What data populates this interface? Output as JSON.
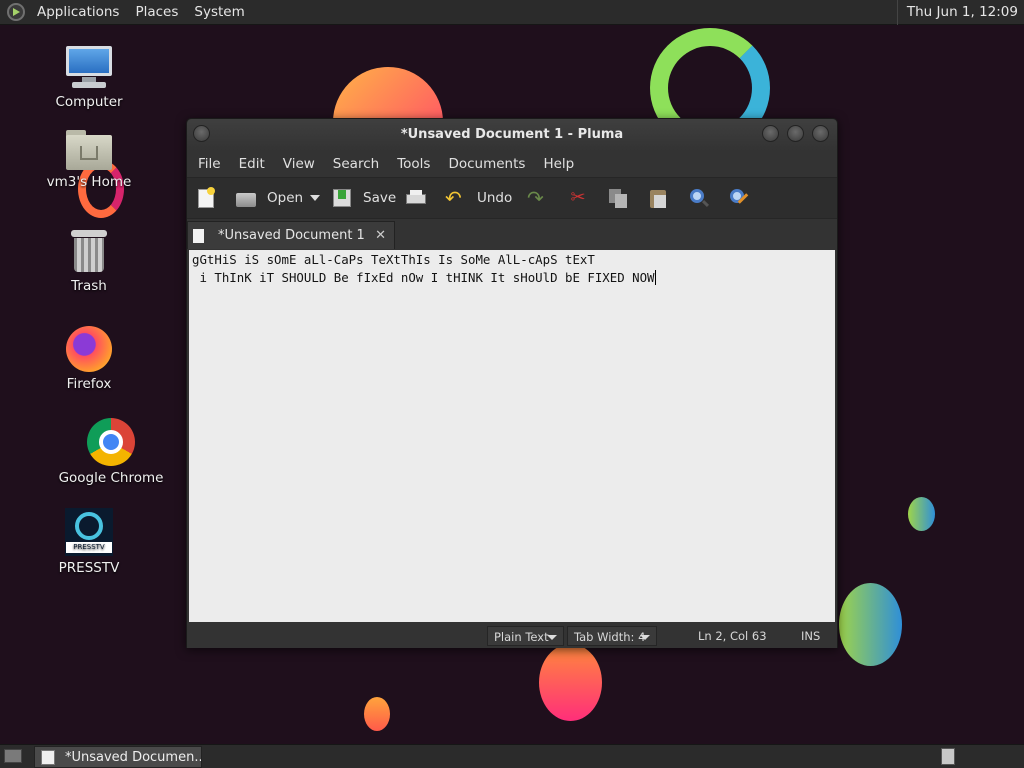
{
  "top_panel": {
    "menus": [
      "Applications",
      "Places",
      "System"
    ],
    "clock": "Thu Jun  1, 12:09"
  },
  "desktop": {
    "icons": [
      {
        "label": "Computer",
        "icon": "computer-icon"
      },
      {
        "label": "vm3's Home",
        "icon": "home-folder-icon"
      },
      {
        "label": "Trash",
        "icon": "trash-icon"
      },
      {
        "label": "Firefox",
        "icon": "firefox-icon"
      },
      {
        "label": "Google Chrome",
        "icon": "chrome-icon"
      },
      {
        "label": "PRESSTV",
        "icon": "presstv-icon",
        "logo_text": "PRESSTV"
      }
    ]
  },
  "window": {
    "title": "*Unsaved Document 1 - Pluma",
    "menu": [
      "File",
      "Edit",
      "View",
      "Search",
      "Tools",
      "Documents",
      "Help"
    ],
    "toolbar": {
      "open_label": "Open",
      "save_label": "Save",
      "undo_label": "Undo"
    },
    "tab": {
      "label": "*Unsaved Document 1",
      "close": "✕"
    },
    "editor": {
      "lines": [
        "gGtHiS iS sOmE aLl-CaPs TeXtThIs Is SoMe AlL-cApS tExT",
        " i ThInK iT SHOULD Be fIxEd nOw I tHINK It sHoUlD bE FIXED NOW"
      ]
    },
    "statusbar": {
      "language": "Plain Text",
      "tab_width": "Tab Width:  4",
      "position": "Ln 2, Col 63",
      "mode": "INS"
    }
  },
  "bottom_panel": {
    "task_label": "*Unsaved Documen..."
  },
  "colors": {
    "desktop_bg": "#1f0f1c",
    "panel_bg": "#2b2b2b",
    "editor_bg": "#ececec"
  }
}
